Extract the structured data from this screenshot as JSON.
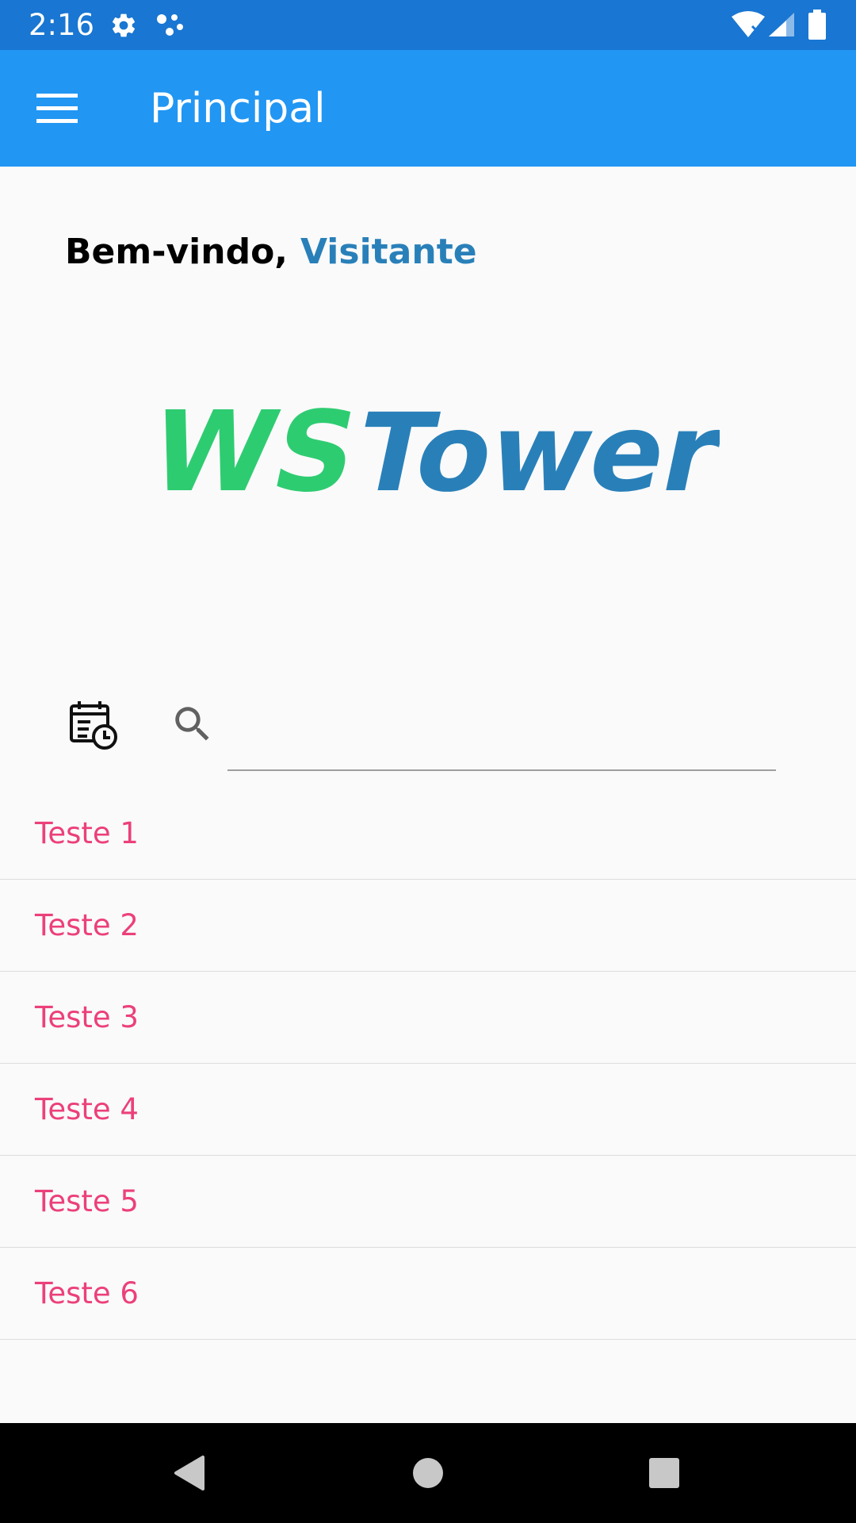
{
  "status_bar": {
    "time": "2:16",
    "background": "#1976d2",
    "icons": [
      "gear-icon",
      "assistant-dots-icon",
      "wifi-icon",
      "signal-icon",
      "battery-icon"
    ]
  },
  "app_bar": {
    "title": "Principal",
    "background": "#2196f3",
    "menu_icon": "hamburger-menu-icon"
  },
  "welcome": {
    "label": "Bem-vindo,",
    "user": "Visitante",
    "user_color": "#2980b9"
  },
  "logo": {
    "text_ws": "WS",
    "text_tower": "Tower",
    "color_ws": "#2ecc71",
    "color_tower": "#2980b9"
  },
  "search": {
    "calendar_icon": "calendar-clock-icon",
    "search_icon": "search-icon",
    "value": "",
    "placeholder": ""
  },
  "list": {
    "item_color": "#ec407a",
    "items": [
      {
        "label": "Teste 1"
      },
      {
        "label": "Teste 2"
      },
      {
        "label": "Teste 3"
      },
      {
        "label": "Teste 4"
      },
      {
        "label": "Teste 5"
      },
      {
        "label": "Teste 6"
      }
    ]
  },
  "nav_bar": {
    "buttons": [
      "back-icon",
      "home-icon",
      "recents-icon"
    ]
  }
}
